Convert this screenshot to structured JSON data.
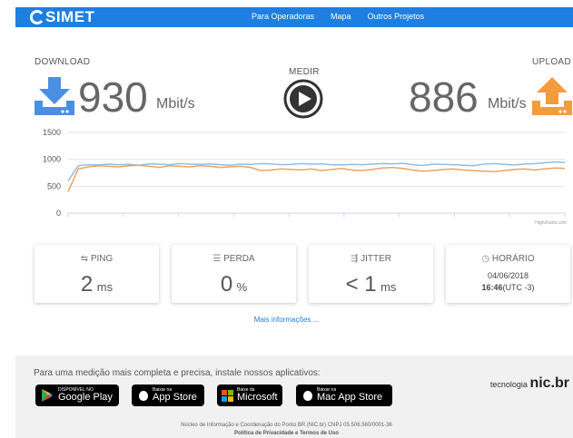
{
  "header": {
    "logo": "SIMET",
    "links": [
      "Para Operadoras",
      "Mapa",
      "Outros Projetos"
    ]
  },
  "download": {
    "label": "DOWNLOAD",
    "value": "930",
    "unit": "Mbit/s"
  },
  "upload": {
    "label": "UPLOAD",
    "value": "886",
    "unit": "Mbit/s"
  },
  "measure": {
    "label": "MEDIR"
  },
  "chart_data": {
    "type": "line",
    "ylim": [
      0,
      1500
    ],
    "yticks": [
      "1500",
      "1000",
      "500",
      "0"
    ],
    "grid": true,
    "credit": "Highcharts.com",
    "series": [
      {
        "color": "#8ebde8",
        "values": [
          600,
          880,
          900,
          895,
          910,
          900,
          905,
          890,
          915,
          910,
          900,
          920,
          910,
          905,
          915,
          900,
          890,
          910,
          905,
          920,
          915,
          900,
          905,
          920,
          910,
          915,
          900,
          895,
          905,
          900,
          910,
          920,
          915,
          925,
          900,
          885,
          910,
          905,
          900,
          890,
          880,
          910,
          920,
          905,
          895,
          910,
          920,
          935,
          950,
          940
        ]
      },
      {
        "color": "#f0a35a",
        "values": [
          400,
          820,
          860,
          880,
          870,
          860,
          880,
          890,
          870,
          850,
          880,
          870,
          860,
          880,
          870,
          850,
          860,
          870,
          850,
          790,
          800,
          820,
          810,
          800,
          820,
          790,
          810,
          830,
          800,
          790,
          810,
          840,
          850,
          830,
          800,
          780,
          790,
          810,
          820,
          800,
          790,
          780,
          770,
          790,
          810,
          820,
          800,
          820,
          840,
          830
        ]
      }
    ]
  },
  "cards": {
    "ping": {
      "title": "PING",
      "value": "2",
      "unit": "ms"
    },
    "loss": {
      "title": "PERDA",
      "value": "0",
      "unit": "%"
    },
    "jitter": {
      "title": "JITTER",
      "value": "< 1",
      "unit": "ms"
    },
    "time": {
      "title": "HORÁRIO",
      "date": "04/06/2018",
      "time": "16:46",
      "tz": "(UTC -3)"
    }
  },
  "more_info": "Mais informações ...",
  "footer": {
    "text": "Para uma medição mais completa e precisa, instale nossos aplicativos:",
    "google": {
      "small": "DISPONÍVEL NO",
      "big": "Google Play"
    },
    "appstore": {
      "small": "Baixar na",
      "big": "App Store"
    },
    "microsoft": {
      "small": "Baixe da",
      "big": "Microsoft"
    },
    "macstore": {
      "small": "Baixar na",
      "big": "Mac App Store"
    },
    "tech_prefix": "tecnologia",
    "tech_brand": "nic.br",
    "nic": "Núcleo de Informação e Coordenação do Ponto BR (NIC.br) CNPJ 05.506.560/0001-36",
    "privacy": "Política de Privacidade e Termos de Uso"
  }
}
